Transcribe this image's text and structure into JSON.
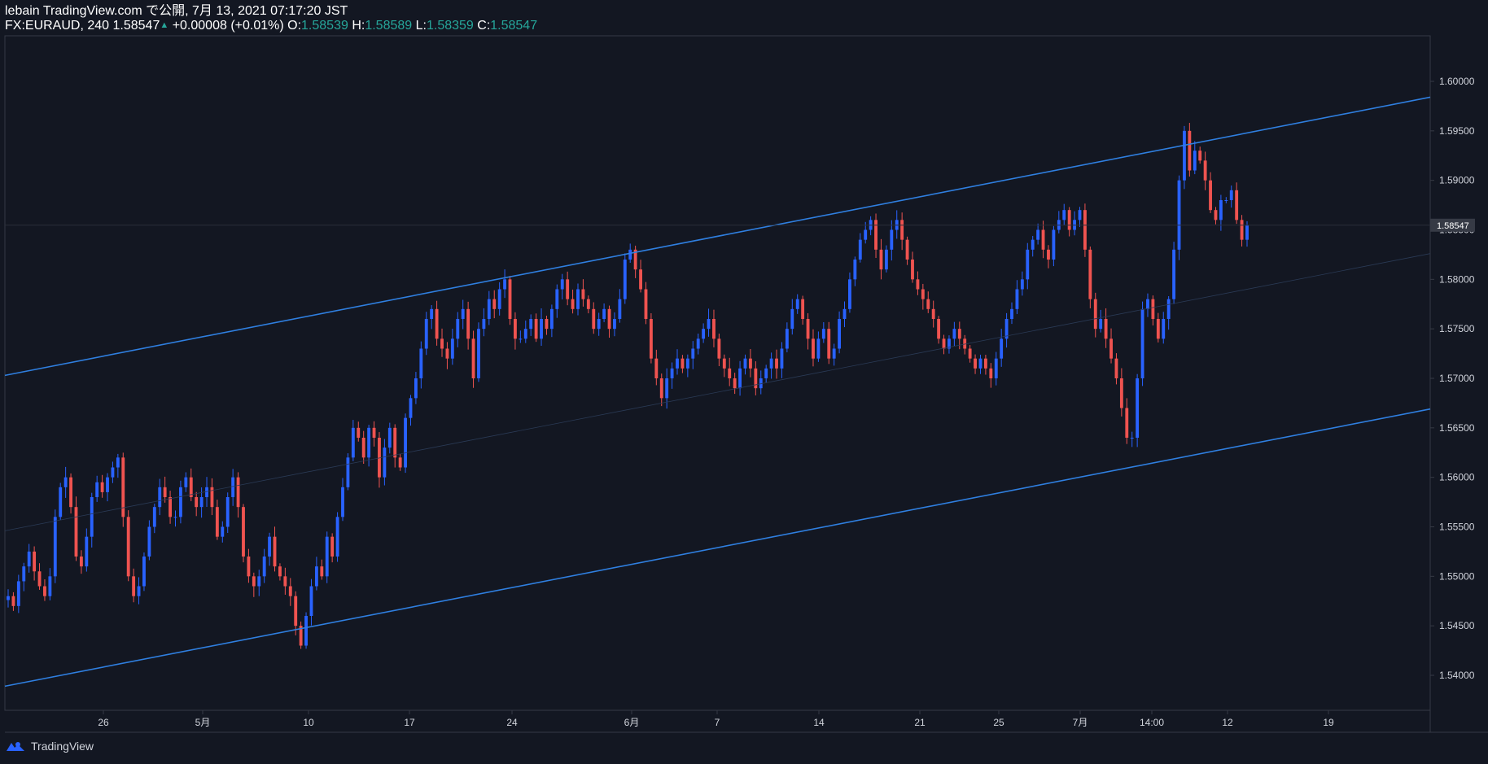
{
  "header": {
    "line1": "lebain TradingView.com で公開, 7月 13, 2021 07:17:20 JST",
    "symbol": "FX:EURAUD, 240",
    "last": "1.58547",
    "change": "+0.00008 (+0.01%)",
    "o_label": "O:",
    "o_value": "1.58539",
    "h_label": "H:",
    "h_value": "1.58589",
    "l_label": "L:",
    "l_value": "1.58359",
    "c_label": "C:",
    "c_value": "1.58547"
  },
  "footer": {
    "brand": "TradingView"
  },
  "colors": {
    "background": "#131722",
    "up": "#2962ff",
    "down": "#ef5350",
    "channel": "#2f7fe0",
    "text": "#d1d4dc",
    "header_value": "#26a69a"
  },
  "chart_data": {
    "type": "candlestick",
    "symbol": "FX:EURAUD",
    "interval": "240",
    "y_ticks": [
      "1.60000",
      "1.59500",
      "1.59000",
      "1.58500",
      "1.58000",
      "1.57500",
      "1.57000",
      "1.56500",
      "1.56000",
      "1.55500",
      "1.55000",
      "1.54500",
      "1.54000"
    ],
    "ylim": [
      1.5365,
      1.6045
    ],
    "last_price_label": "1.58547",
    "x_ticks": [
      "26",
      "5月",
      "10",
      "17",
      "24",
      "6月",
      "7",
      "14",
      "21",
      "25",
      "7月",
      "14:00",
      "12",
      "19"
    ],
    "channel_lines": [
      {
        "name": "upper",
        "from": {
          "x": "4/20",
          "y": 1.5703
        },
        "to": {
          "x": "7/18",
          "y": 1.5984
        }
      },
      {
        "name": "lower",
        "from": {
          "x": "4/20",
          "y": 1.5389
        },
        "to": {
          "x": "7/18",
          "y": 1.5669
        }
      },
      {
        "name": "mid",
        "from": {
          "x": "4/20",
          "y": 1.5546
        },
        "to": {
          "x": "7/18",
          "y": 1.5826
        }
      }
    ],
    "closes_approx": [
      1.548,
      1.547,
      1.5495,
      1.551,
      1.5525,
      1.5505,
      1.549,
      1.548,
      1.55,
      1.556,
      1.559,
      1.56,
      1.557,
      1.552,
      1.551,
      1.554,
      1.558,
      1.5595,
      1.5585,
      1.56,
      1.561,
      1.562,
      1.556,
      1.55,
      1.548,
      1.549,
      1.552,
      1.555,
      1.557,
      1.559,
      1.558,
      1.556,
      1.556,
      1.559,
      1.56,
      1.558,
      1.557,
      1.558,
      1.559,
      1.557,
      1.554,
      1.555,
      1.558,
      1.56,
      1.557,
      1.552,
      1.55,
      1.549,
      1.55,
      1.552,
      1.554,
      1.551,
      1.55,
      1.549,
      1.548,
      1.545,
      1.543,
      1.546,
      1.549,
      1.551,
      1.55,
      1.554,
      1.552,
      1.556,
      1.559,
      1.562,
      1.565,
      1.564,
      1.562,
      1.565,
      1.564,
      1.56,
      1.563,
      1.565,
      1.562,
      1.561,
      1.566,
      1.568,
      1.57,
      1.573,
      1.576,
      1.577,
      1.574,
      1.573,
      1.572,
      1.574,
      1.576,
      1.577,
      1.574,
      1.57,
      1.575,
      1.576,
      1.578,
      1.577,
      1.579,
      1.58,
      1.576,
      1.574,
      1.574,
      1.575,
      1.576,
      1.574,
      1.576,
      1.575,
      1.577,
      1.579,
      1.58,
      1.578,
      1.577,
      1.579,
      1.578,
      1.577,
      1.575,
      1.576,
      1.577,
      1.575,
      1.576,
      1.578,
      1.582,
      1.583,
      1.581,
      1.579,
      1.576,
      1.572,
      1.57,
      1.568,
      1.57,
      1.571,
      1.572,
      1.571,
      1.572,
      1.573,
      1.574,
      1.575,
      1.576,
      1.574,
      1.572,
      1.571,
      1.57,
      1.569,
      1.571,
      1.572,
      1.571,
      1.569,
      1.57,
      1.571,
      1.572,
      1.571,
      1.573,
      1.575,
      1.577,
      1.578,
      1.576,
      1.574,
      1.572,
      1.574,
      1.575,
      1.572,
      1.573,
      1.576,
      1.577,
      1.58,
      1.582,
      1.584,
      1.585,
      1.586,
      1.583,
      1.581,
      1.583,
      1.585,
      1.586,
      1.584,
      1.582,
      1.58,
      1.579,
      1.578,
      1.577,
      1.576,
      1.574,
      1.573,
      1.574,
      1.575,
      1.574,
      1.573,
      1.572,
      1.571,
      1.572,
      1.571,
      1.57,
      1.572,
      1.574,
      1.576,
      1.577,
      1.579,
      1.58,
      1.583,
      1.584,
      1.585,
      1.583,
      1.582,
      1.585,
      1.586,
      1.587,
      1.585,
      1.586,
      1.587,
      1.583,
      1.578,
      1.575,
      1.576,
      1.574,
      1.572,
      1.57,
      1.567,
      1.564,
      1.564,
      1.57,
      1.577,
      1.578,
      1.576,
      1.574,
      1.576,
      1.578,
      1.583,
      1.59,
      1.595,
      1.591,
      1.593,
      1.592,
      1.59,
      1.587,
      1.586,
      1.588,
      1.588,
      1.589,
      1.586,
      1.584,
      1.5855
    ]
  }
}
